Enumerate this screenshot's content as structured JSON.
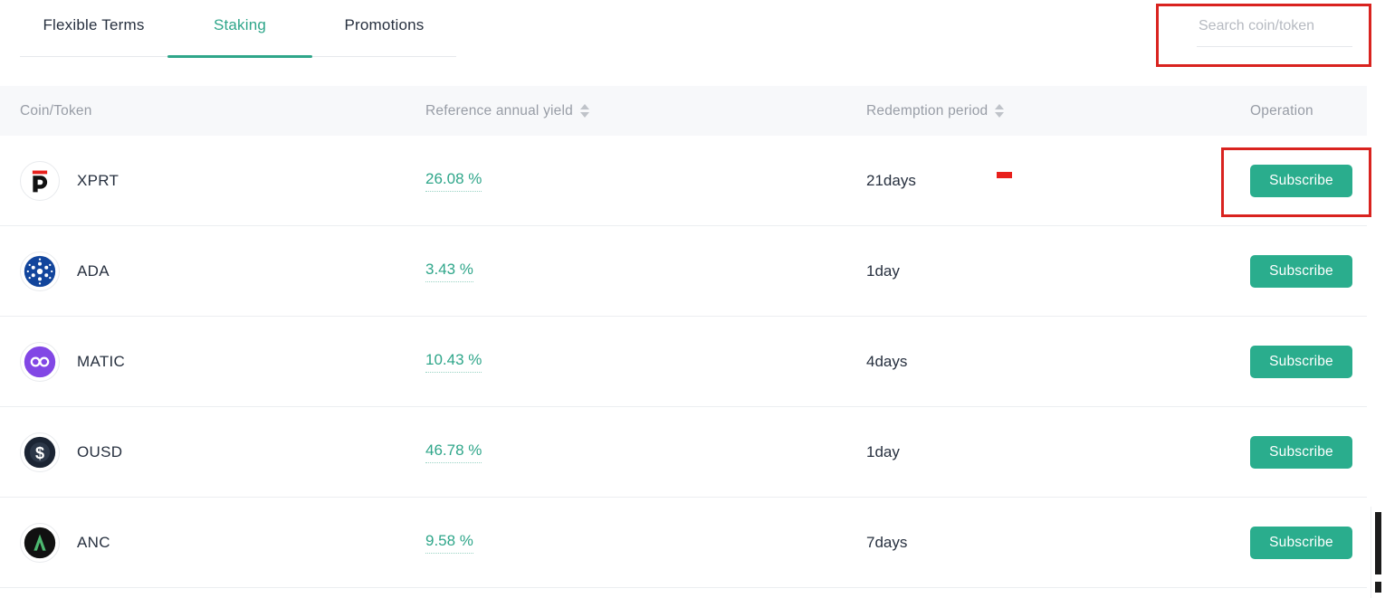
{
  "tabs": [
    {
      "label": "Flexible Terms",
      "active": false
    },
    {
      "label": "Staking",
      "active": true
    },
    {
      "label": "Promotions",
      "active": false
    }
  ],
  "search": {
    "placeholder": "Search coin/token",
    "value": ""
  },
  "table": {
    "headers": {
      "coin": "Coin/Token",
      "yield": "Reference annual yield",
      "period": "Redemption period",
      "operation": "Operation"
    },
    "rows": [
      {
        "coin": "XPRT",
        "icon": "xprt-coin-icon",
        "yield": "26.08 %",
        "period": "21days",
        "action": "Subscribe"
      },
      {
        "coin": "ADA",
        "icon": "ada-coin-icon",
        "yield": "3.43 %",
        "period": "1day",
        "action": "Subscribe"
      },
      {
        "coin": "MATIC",
        "icon": "matic-coin-icon",
        "yield": "10.43 %",
        "period": "4days",
        "action": "Subscribe"
      },
      {
        "coin": "OUSD",
        "icon": "ousd-coin-icon",
        "yield": "46.78 %",
        "period": "1day",
        "action": "Subscribe"
      },
      {
        "coin": "ANC",
        "icon": "anc-coin-icon",
        "yield": "9.58 %",
        "period": "7days",
        "action": "Subscribe"
      }
    ]
  },
  "colors": {
    "accent": "#2fa68a",
    "button": "#2aad8d",
    "annotation": "#d9231f",
    "header_bg": "#f7f8fa",
    "text": "#27303f",
    "muted": "#989da6"
  }
}
